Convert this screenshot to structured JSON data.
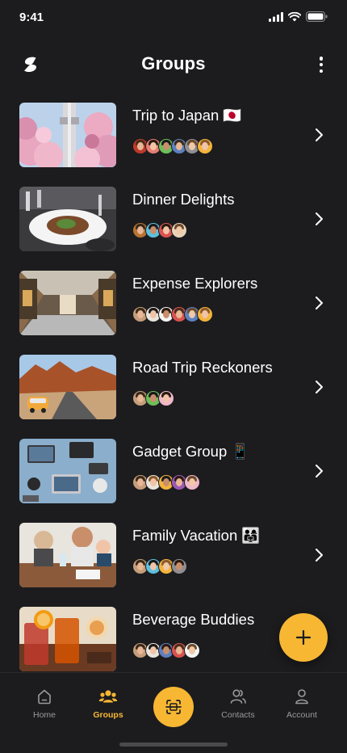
{
  "status_bar": {
    "time": "9:41"
  },
  "header": {
    "title": "Groups"
  },
  "groups": [
    {
      "name": "Trip to Japan 🇯🇵",
      "avatar_count": 6,
      "theme": "japan"
    },
    {
      "name": "Dinner Delights",
      "avatar_count": 4,
      "theme": "dinner"
    },
    {
      "name": "Expense Explorers",
      "avatar_count": 6,
      "theme": "arcade"
    },
    {
      "name": "Road Trip Reckoners",
      "avatar_count": 3,
      "theme": "road"
    },
    {
      "name": "Gadget Group 📱",
      "avatar_count": 5,
      "theme": "gadget"
    },
    {
      "name": "Family Vacation 👨‍👩‍👧",
      "avatar_count": 4,
      "theme": "family"
    },
    {
      "name": "Beverage Buddies",
      "avatar_count": 5,
      "theme": "beverage"
    }
  ],
  "tabs": [
    {
      "label": "Home",
      "icon": "home-icon",
      "active": false
    },
    {
      "label": "Groups",
      "icon": "groups-icon",
      "active": true
    },
    {
      "label": "Contacts",
      "icon": "contacts-icon",
      "active": false
    },
    {
      "label": "Account",
      "icon": "account-icon",
      "active": false
    }
  ],
  "colors": {
    "accent": "#f7b733",
    "background": "#1c1c1e",
    "inactive": "#9a9a9e"
  }
}
